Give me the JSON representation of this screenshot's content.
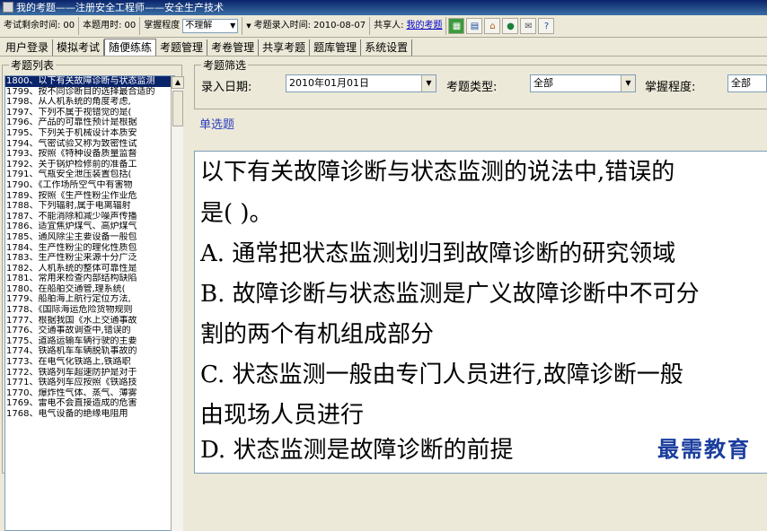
{
  "window": {
    "title": "我的考题——注册安全工程师——安全生产技术"
  },
  "toolbar": {
    "remaining_label": "考试剩余时间:",
    "remaining_value": "00",
    "used_label": "本题用时:",
    "used_value": "00",
    "mastery_label": "掌握程度",
    "mastery_value": "不理解",
    "entry_label": "考题录入时间:",
    "entry_value": "2010-08-07",
    "sharer_label": "共享人:",
    "sharer_value": "我的考题"
  },
  "menu": {
    "tabs": [
      "用户登录",
      "模拟考试",
      "随便练练",
      "考题管理",
      "考卷管理",
      "共享考题",
      "题库管理",
      "系统设置"
    ],
    "active_index": 2
  },
  "question_list": {
    "legend": "考题列表",
    "items": [
      "1800、以下有关故障诊断与状态监测",
      "1799、按不同诊断目的选择最合适的",
      "1798、从人机系统的角度考虑,",
      "1797、下列不属于视错觉的是(",
      "1796、产品的可靠性预计是根据",
      "1795、下列关于机械设计本质安",
      "1794、气密试验又称为致密性试",
      "1793、按照《特种设备质量监督",
      "1792、关于锅炉检修前的准备工",
      "1791、气瓶安全泄压装置包括(",
      "1790、《工作场所空气中有害物",
      "1789、按照《生产性粉尘作业危",
      "1788、下列辐射,属于电离辐射",
      "1787、不能消除和减少噪声传播",
      "1786、适宜焦炉煤气、高炉煤气",
      "1785、通风除尘主要设备一般包",
      "1784、生产性粉尘的理化性质包",
      "1783、生产性粉尘来源十分广泛",
      "1782、人机系统的整体可靠性是",
      "1781、常用来检查内部结构缺陷",
      "1780、在船舶交通管,理系统(",
      "1779、船舶海上航行定位方法,",
      "1778、《国际海运危险货物规则",
      "1777、根据我国《水上交通事故",
      "1776、交通事故调查中,错误的",
      "1775、道路运输车辆行驶的主要",
      "1774、铁路机车车辆脱轨事故的",
      "1773、在电气化铁路上,铁路职",
      "1772、铁路列车超速防护是对于",
      "1771、铁路列车应按照《铁路技",
      "1770、爆炸性气体、蒸气、薄雾",
      "1769、雷电不会直接造成的危害",
      "1768、电气设备的绝缘电阻用"
    ]
  },
  "filter": {
    "legend": "考题筛选",
    "date_label": "录入日期:",
    "date_value": "2010年01月01日",
    "type_label": "考题类型:",
    "type_value": "全部",
    "mastery_label": "掌握程度:",
    "mastery_value": "全部"
  },
  "question": {
    "type": "单选题",
    "lines": [
      "以下有关故障诊断与状态监测的说法中,错误的",
      "是(        )。",
      "A. 通常把状态监测划归到故障诊断的研究领域",
      "B. 故障诊断与状态监测是广义故障诊断中不可分",
      "割的两个有机组成部分",
      "C. 状态监测一般由专门人员进行,故障诊断一般",
      "由现场人员进行",
      "D. 状态监测是故障诊断的前提"
    ]
  },
  "watermark": "最需教育"
}
